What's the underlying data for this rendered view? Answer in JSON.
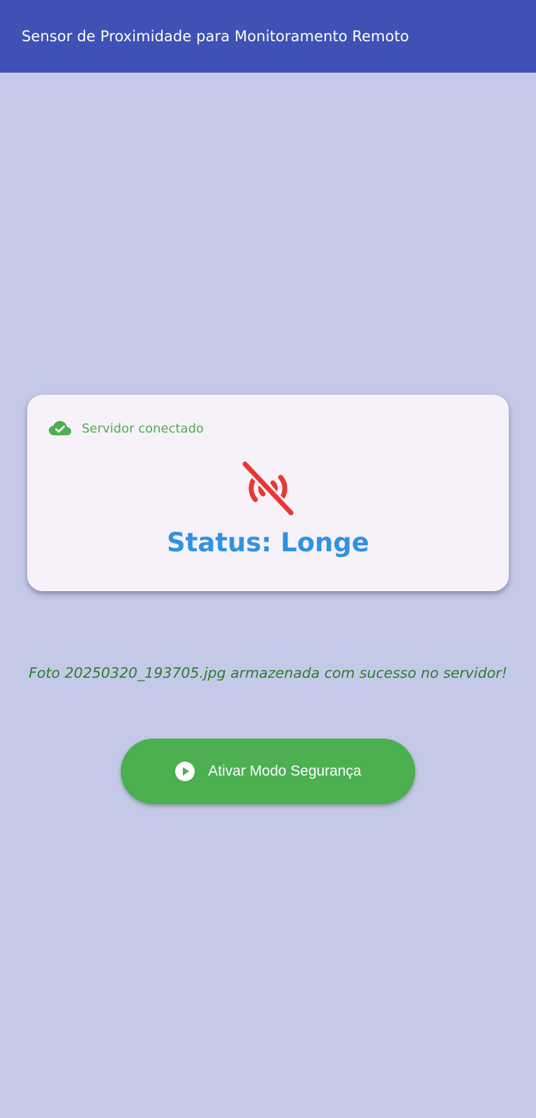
{
  "app_bar": {
    "title": "Sensor de Proximidade para Monitoramento Remoto",
    "background_color": "#3f51b5"
  },
  "status_card": {
    "server": {
      "icon": "cloud-done-icon",
      "label": "Servidor conectado",
      "color": "#4caf50"
    },
    "sensor_icon": "sensors-off-icon",
    "sensor_icon_color": "#e53935",
    "status_text": "Status: Longe",
    "status_color": "#2f93e0"
  },
  "message": {
    "text": "Foto 20250320_193705.jpg armazenada com sucesso no servidor!",
    "color": "#2e7d32"
  },
  "action_button": {
    "icon": "play-circle-icon",
    "label": "Ativar Modo Segurança",
    "color": "#4caf50"
  },
  "background_color": "#c5c9e8"
}
